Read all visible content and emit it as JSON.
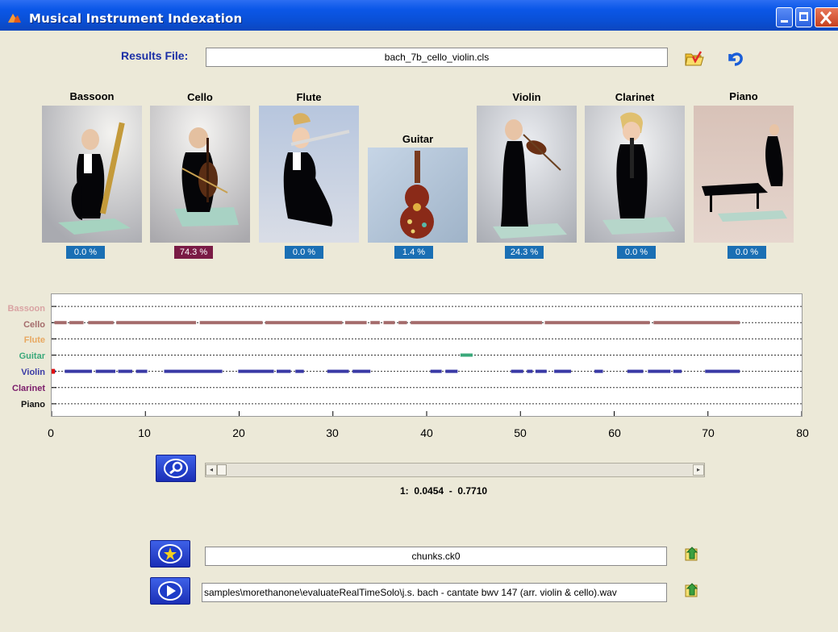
{
  "window": {
    "title": "Musical Instrument Indexation"
  },
  "results": {
    "label": "Results File:",
    "file": "bach_7b_cello_violin.cls"
  },
  "instruments": [
    {
      "name": "Bassoon",
      "percent": "0.0 %",
      "badge_color": "#1a6fb4"
    },
    {
      "name": "Cello",
      "percent": "74.3 %",
      "badge_color": "#7a1b45"
    },
    {
      "name": "Flute",
      "percent": "0.0 %",
      "badge_color": "#1a6fb4"
    },
    {
      "name": "Guitar",
      "percent": "1.4 %",
      "badge_color": "#1a6fb4"
    },
    {
      "name": "Violin",
      "percent": "24.3 %",
      "badge_color": "#1a6fb4"
    },
    {
      "name": "Clarinet",
      "percent": "0.0 %",
      "badge_color": "#1a6fb4"
    },
    {
      "name": "Piano",
      "percent": "0.0 %",
      "badge_color": "#1a6fb4"
    }
  ],
  "chart_data": {
    "type": "timeline",
    "xlim": [
      0,
      80
    ],
    "xticks": [
      "0",
      "10",
      "20",
      "30",
      "40",
      "50",
      "60",
      "70",
      "80"
    ],
    "rows": [
      {
        "name": "Bassoon",
        "color": "#d9a3a3",
        "segments": []
      },
      {
        "name": "Cello",
        "color": "#a46b6b",
        "segments": [
          [
            0.3,
            1.6
          ],
          [
            1.9,
            3.4
          ],
          [
            3.9,
            6.6
          ],
          [
            6.9,
            15.4
          ],
          [
            15.8,
            22.5
          ],
          [
            22.8,
            31.0
          ],
          [
            31.3,
            33.6
          ],
          [
            34.0,
            35.0
          ],
          [
            35.4,
            36.6
          ],
          [
            37.0,
            37.9
          ],
          [
            38.3,
            52.3
          ],
          [
            52.6,
            63.8
          ],
          [
            64.2,
            73.4
          ]
        ]
      },
      {
        "name": "Flute",
        "color": "#e8a860",
        "segments": []
      },
      {
        "name": "Guitar",
        "color": "#3aa87a",
        "segments": [
          [
            43.6,
            44.9
          ]
        ]
      },
      {
        "name": "Violin",
        "color": "#3a3aa6",
        "segments": [
          [
            0.0,
            0.4
          ],
          [
            1.4,
            4.3
          ],
          [
            4.7,
            6.8
          ],
          [
            7.1,
            8.6
          ],
          [
            9.0,
            10.2
          ],
          [
            12.0,
            18.2
          ],
          [
            19.9,
            23.7
          ],
          [
            24.0,
            25.5
          ],
          [
            26.0,
            26.9
          ],
          [
            29.4,
            31.7
          ],
          [
            32.1,
            34.0
          ],
          [
            40.4,
            41.6
          ],
          [
            42.0,
            43.3
          ],
          [
            49.0,
            50.3
          ],
          [
            50.7,
            51.3
          ],
          [
            51.6,
            52.8
          ],
          [
            53.6,
            55.4
          ],
          [
            57.9,
            58.8
          ],
          [
            61.4,
            63.1
          ],
          [
            63.6,
            66.0
          ],
          [
            66.3,
            67.2
          ],
          [
            69.7,
            73.4
          ]
        ]
      },
      {
        "name": "Clarinet",
        "color": "#7a1b6a",
        "segments": []
      },
      {
        "name": "Piano",
        "color": "#111111",
        "segments": []
      }
    ]
  },
  "range": {
    "text": "1:  0.0454  -  0.7710"
  },
  "chunks": {
    "file": "chunks.ck0"
  },
  "audio": {
    "file": "samples\\morethanone\\evaluateRealTimeSolo\\j.s. bach - cantate bwv 147 (arr. violin & cello).wav"
  }
}
